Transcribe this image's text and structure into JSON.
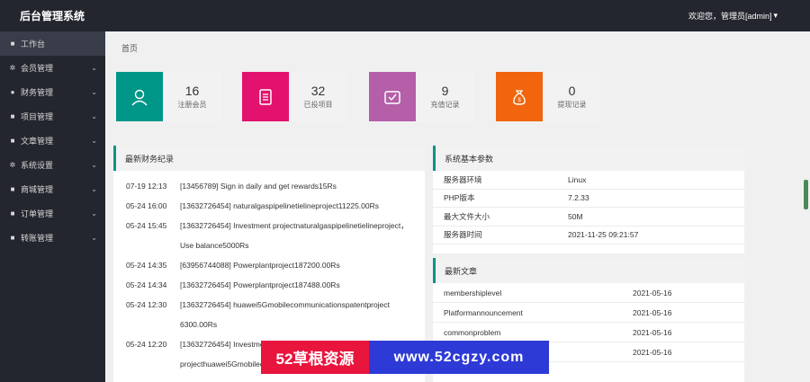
{
  "header": {
    "title": "后台管理系统",
    "welcome": "欢迎您，管理员[admin]"
  },
  "sidebar": {
    "items": [
      {
        "label": "工作台",
        "icon": "grid-icon",
        "expandable": false
      },
      {
        "label": "会员管理",
        "icon": "gear-icon",
        "expandable": true
      },
      {
        "label": "财务管理",
        "icon": "info-icon",
        "expandable": true
      },
      {
        "label": "项目管理",
        "icon": "grid-icon",
        "expandable": true
      },
      {
        "label": "文章管理",
        "icon": "grid-icon",
        "expandable": true
      },
      {
        "label": "系统设置",
        "icon": "gear-icon",
        "expandable": true
      },
      {
        "label": "商城管理",
        "icon": "grid-icon",
        "expandable": true
      },
      {
        "label": "订单管理",
        "icon": "grid-icon",
        "expandable": true
      },
      {
        "label": "转账管理",
        "icon": "grid-icon",
        "expandable": true
      }
    ]
  },
  "breadcrumb": "首页",
  "stats": [
    {
      "value": "16",
      "label": "注册会员",
      "color": "#009688",
      "icon": "user-icon"
    },
    {
      "value": "32",
      "label": "已投项目",
      "color": "#e2126e",
      "icon": "document-icon"
    },
    {
      "value": "9",
      "label": "充值记录",
      "color": "#b45fa8",
      "icon": "wallet-icon"
    },
    {
      "value": "0",
      "label": "提现记录",
      "color": "#f0650d",
      "icon": "money-bag-icon"
    }
  ],
  "finance": {
    "title": "最新财务纪录",
    "rows": [
      {
        "date": "07-19 12:13",
        "text": "[13456789] Sign in daily and get rewards15Rs"
      },
      {
        "date": "05-24 16:00",
        "text": "[13632726454] naturalgaspipelinetielineproject11225.00Rs"
      },
      {
        "date": "05-24 15:45",
        "text": "[13632726454] Investment projectnaturalgaspipelinetielineproject，Use balance5000Rs"
      },
      {
        "date": "05-24 14:35",
        "text": "[63956744088] Powerplantproject187200.00Rs"
      },
      {
        "date": "05-24 14:34",
        "text": "[13632726454] Powerplantproject187488.00Rs"
      },
      {
        "date": "05-24 12:30",
        "text": "[13632726454] huawei5Gmobilecommunicationspatentproject 6300.00Rs"
      },
      {
        "date": "05-24 12:20",
        "text": "[13632726454] Investment projecthuawei5Gmobilecommunicationspatentproject"
      }
    ]
  },
  "params": {
    "title": "系统基本参数",
    "rows": [
      {
        "key": "服务器环境",
        "value": "Linux"
      },
      {
        "key": "PHP版本",
        "value": "7.2.33"
      },
      {
        "key": "最大文件大小",
        "value": "50M"
      },
      {
        "key": "服务器时间",
        "value": "2021-11-25 09:21:57"
      }
    ]
  },
  "news": {
    "title": "最新文章",
    "rows": [
      {
        "title": "membershiplevel",
        "date": "2021-05-16"
      },
      {
        "title": "Platformannouncement",
        "date": "2021-05-16"
      },
      {
        "title": "commonproblem",
        "date": "2021-05-16"
      },
      {
        "title": "",
        "date": "2021-05-16"
      }
    ]
  },
  "watermark": {
    "left": "52草根资源",
    "right": "www.52cgzy.com"
  },
  "colors": {
    "sidebar": "#23262e",
    "accent": "#009688"
  }
}
